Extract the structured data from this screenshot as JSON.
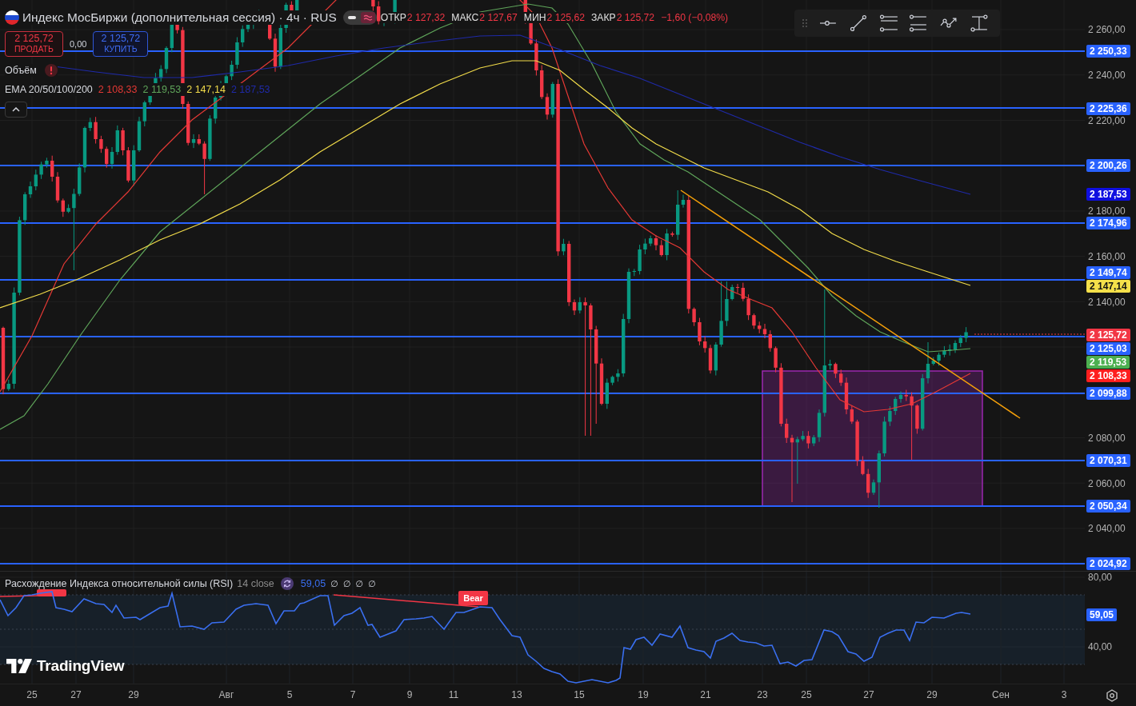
{
  "legend": {
    "title": "Индекс МосБиржи (дополнительная сессия) · 4ч · RUS",
    "status_switch": [
      {
        "kind": "dash",
        "selected": false
      },
      {
        "kind": "wave",
        "selected": true
      }
    ],
    "ohlc": [
      {
        "label": "ОТКР",
        "value": "2 127,32"
      },
      {
        "label": "МАКС",
        "value": "2 127,67"
      },
      {
        "label": "МИН",
        "value": "2 125,62"
      },
      {
        "label": "ЗАКР",
        "value": "2 125,72"
      }
    ],
    "change": "−1,60 (−0,08%)"
  },
  "trade": {
    "sell": {
      "price": "2 125,72",
      "label": "ПРОДАТЬ"
    },
    "spread": "0,00",
    "buy": {
      "price": "2 125,72",
      "label": "КУПИТЬ"
    }
  },
  "indicators": [
    {
      "kind": "volume",
      "name": "Объём",
      "error": true
    },
    {
      "kind": "ema",
      "name": "EMA 20/50/100/200",
      "error": false,
      "values": [
        {
          "text": "2 108,33",
          "color": "#e53935"
        },
        {
          "text": "2 119,53",
          "color": "#5fa55a"
        },
        {
          "text": "2 147,14",
          "color": "#f2dc4a"
        },
        {
          "text": "2 187,53",
          "color": "#1f2aa8"
        }
      ]
    }
  ],
  "price_axis": {
    "labels": [
      {
        "text": "2 260,00",
        "kind": "tick"
      },
      {
        "text": "2 250,33",
        "kind": "level",
        "color": "#2962ff"
      },
      {
        "text": "2 240,00",
        "kind": "tick"
      },
      {
        "text": "2 225,36",
        "kind": "level",
        "color": "#2962ff"
      },
      {
        "text": "2 220,00",
        "kind": "tick"
      },
      {
        "text": "2 200,26",
        "kind": "level",
        "color": "#2962ff"
      },
      {
        "text": "2 187,53",
        "kind": "ema",
        "color": "#0f0fe0"
      },
      {
        "text": "2 180,00",
        "kind": "tick"
      },
      {
        "text": "2 174,96",
        "kind": "level",
        "color": "#2962ff"
      },
      {
        "text": "2 160,00",
        "kind": "tick"
      },
      {
        "text": "2 149,74",
        "kind": "level",
        "color": "#2962ff"
      },
      {
        "text": "2 147,14",
        "kind": "ema",
        "color": "#f5e04a"
      },
      {
        "text": "2 140,00",
        "kind": "tick"
      },
      {
        "text": "2 125,72",
        "kind": "price",
        "color": "#f23645"
      },
      {
        "text": "2 125,03",
        "kind": "level",
        "color": "#2962ff"
      },
      {
        "text": "2 119,53",
        "kind": "ema",
        "color": "#4caf50"
      },
      {
        "text": "2 108,33",
        "kind": "ema",
        "color": "#ff1e1e"
      },
      {
        "text": "2 099,88",
        "kind": "level",
        "color": "#2962ff"
      },
      {
        "text": "2 080,00",
        "kind": "tick"
      },
      {
        "text": "2 070,31",
        "kind": "level",
        "color": "#2962ff"
      },
      {
        "text": "2 060,00",
        "kind": "tick"
      },
      {
        "text": "2 050,34",
        "kind": "level",
        "color": "#2962ff"
      },
      {
        "text": "2 040,00",
        "kind": "tick"
      },
      {
        "text": "2 024,92",
        "kind": "level",
        "color": "#2962ff"
      }
    ]
  },
  "rsi": {
    "title": "Расхождение Индекса относительной силы (RSI)",
    "params": "14 close",
    "value": "59,05",
    "empty_values": [
      "∅",
      "∅",
      "∅",
      "∅"
    ],
    "signals": [
      {
        "label": "Bear"
      }
    ],
    "axis": {
      "labels": [
        {
          "text": "80,00",
          "kind": "tick"
        },
        {
          "text": "59,05",
          "kind": "value",
          "color": "#2962ff"
        },
        {
          "text": "40,00",
          "kind": "tick"
        }
      ]
    }
  },
  "time_axis": {
    "labels": [
      "25",
      "27",
      "29",
      "Авг",
      "5",
      "7",
      "9",
      "11",
      "13",
      "15",
      "19",
      "21",
      "23",
      "25",
      "27",
      "29",
      "Сен",
      "3"
    ]
  },
  "branding": {
    "name": "TradingView"
  }
}
